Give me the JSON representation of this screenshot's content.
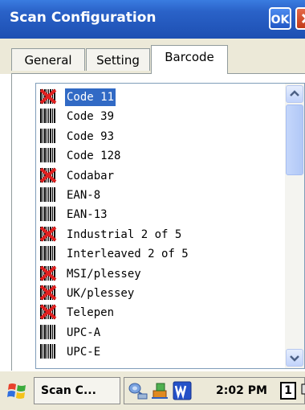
{
  "window": {
    "title": "Scan Configuration",
    "ok_label": "OK"
  },
  "tabs": [
    {
      "label": "General"
    },
    {
      "label": "Setting"
    },
    {
      "label": "Barcode",
      "active": true
    }
  ],
  "symbologies": [
    {
      "label": "Code 11",
      "icon": "disabled-barcode-icon",
      "enabled": false,
      "selected": true
    },
    {
      "label": "Code 39",
      "icon": "barcode-icon",
      "enabled": true
    },
    {
      "label": "Code 93",
      "icon": "barcode-icon",
      "enabled": true
    },
    {
      "label": "Code 128",
      "icon": "barcode-icon",
      "enabled": true
    },
    {
      "label": "Codabar",
      "icon": "disabled-barcode-icon",
      "enabled": false
    },
    {
      "label": "EAN-8",
      "icon": "barcode-icon",
      "enabled": true
    },
    {
      "label": "EAN-13",
      "icon": "barcode-icon",
      "enabled": true
    },
    {
      "label": "Industrial 2 of 5",
      "icon": "disabled-barcode-icon",
      "enabled": false
    },
    {
      "label": "Interleaved 2 of 5",
      "icon": "barcode-icon",
      "enabled": true
    },
    {
      "label": "MSI/plessey",
      "icon": "disabled-barcode-icon",
      "enabled": false
    },
    {
      "label": "UK/plessey",
      "icon": "disabled-barcode-icon",
      "enabled": false
    },
    {
      "label": "Telepen",
      "icon": "disabled-barcode-icon",
      "enabled": false
    },
    {
      "label": "UPC-A",
      "icon": "barcode-icon",
      "enabled": true
    },
    {
      "label": "UPC-E",
      "icon": "barcode-icon",
      "enabled": true
    }
  ],
  "taskbar": {
    "task_label": "Scan C...",
    "time": "2:02 PM",
    "page_indicator": "1"
  },
  "colors": {
    "titlebar": "#1d4fb2",
    "selection": "#316ac5",
    "disabled_mark": "#e02020"
  }
}
